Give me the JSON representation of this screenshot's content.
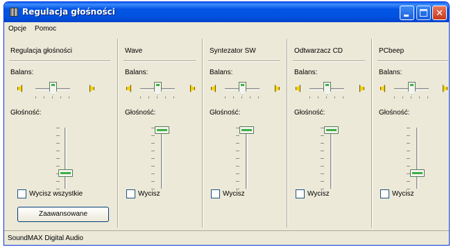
{
  "window": {
    "title": "Regulacja głośności"
  },
  "menu": {
    "items": [
      "Opcje",
      "Pomoc"
    ]
  },
  "channels": [
    {
      "name": "Regulacja głośności",
      "balance_label": "Balans:",
      "volume_label": "Głośność:",
      "mute_label": "Wycisz wszystkie",
      "volume_level": 0.2,
      "balance": 0.0
    },
    {
      "name": "Wave",
      "balance_label": "Balans:",
      "volume_label": "Głośność:",
      "mute_label": "Wycisz",
      "volume_level": 1.0,
      "balance": 0.0
    },
    {
      "name": "Syntezator SW",
      "balance_label": "Balans:",
      "volume_label": "Głośność:",
      "mute_label": "Wycisz",
      "volume_level": 1.0,
      "balance": 0.0
    },
    {
      "name": "Odtwarzacz CD",
      "balance_label": "Balans:",
      "volume_label": "Głośność:",
      "mute_label": "Wycisz",
      "volume_level": 1.0,
      "balance": 0.0
    },
    {
      "name": "PCbeep",
      "balance_label": "Balans:",
      "volume_label": "Głośność:",
      "mute_label": "Wycisz",
      "volume_level": 0.2,
      "balance": 0.0
    }
  ],
  "advanced_button": "Zaawansowane",
  "status": {
    "text": "SoundMAX Digital Audio"
  },
  "colors": {
    "title_bar": "#0055e5",
    "close_button": "#d4502e",
    "thumb_accent": "#3cb043",
    "face": "#ece9d8"
  }
}
